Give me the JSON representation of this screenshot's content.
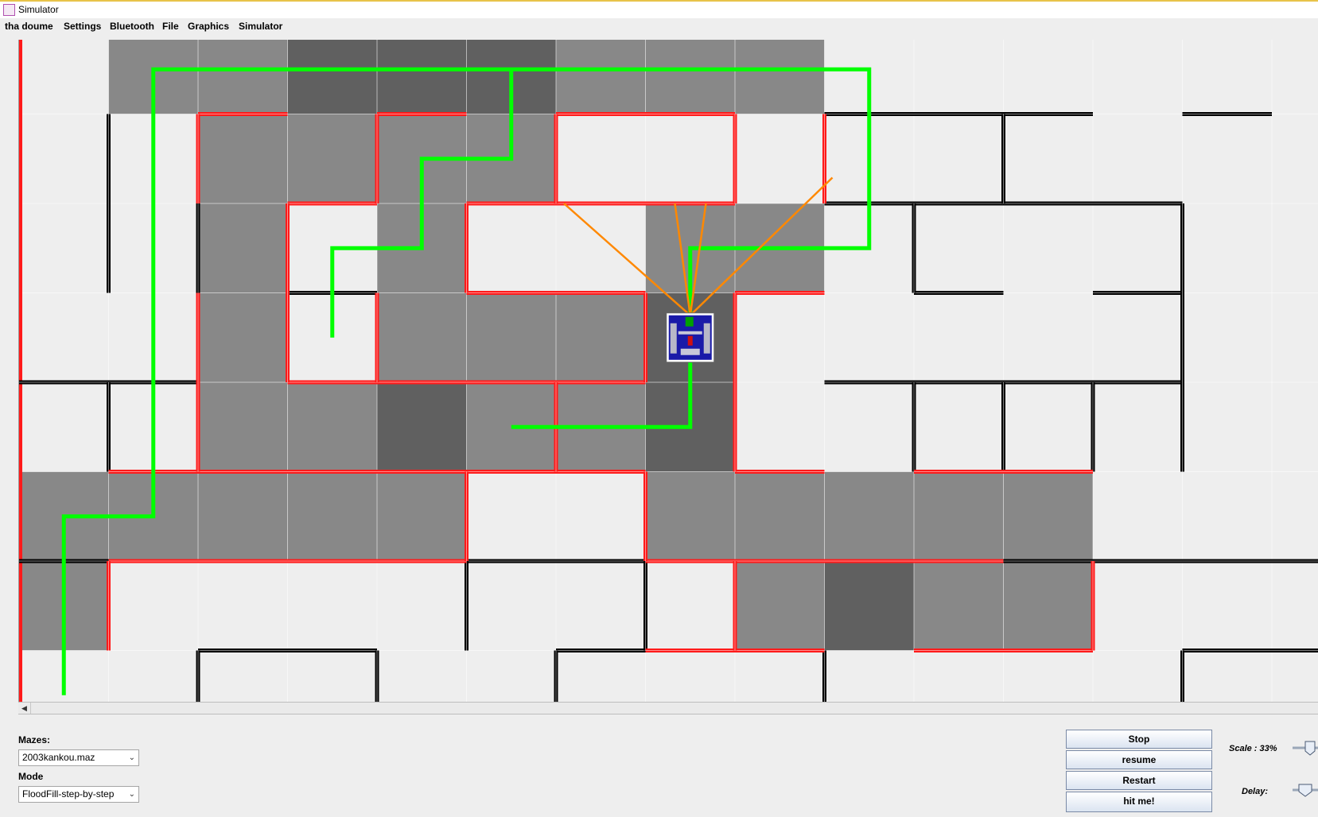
{
  "window": {
    "title": "Simulator"
  },
  "menu": [
    "tha doume",
    "Settings",
    "Bluetooth",
    "File",
    "Graphics",
    "Simulator"
  ],
  "controls": {
    "mazes_label": "Mazes:",
    "maze_selected": "2003kankou.maz",
    "mode_label": "Mode",
    "mode_selected": "FloodFill-step-by-step"
  },
  "buttons": {
    "stop": "Stop",
    "resume": "resume",
    "restart": "Restart",
    "hit": "hit me!"
  },
  "scale_label": "Scale : 33%",
  "delay_label": "Delay:",
  "colors": {
    "floor": "#eeeeee",
    "visited": "#888888",
    "visited_dark": "#606060",
    "path": "#00ff00",
    "known_wall": "#ff1a1a",
    "wall": "#000000",
    "sensor": "#ff8800"
  },
  "maze": {
    "cells_visited": [
      [
        1,
        0
      ],
      [
        2,
        0
      ],
      [
        6,
        0
      ],
      [
        7,
        0
      ],
      [
        8,
        0
      ],
      [
        2,
        1
      ],
      [
        3,
        1
      ],
      [
        4,
        1
      ],
      [
        5,
        1
      ],
      [
        2,
        2
      ],
      [
        4,
        2
      ],
      [
        7,
        2
      ],
      [
        8,
        2
      ],
      [
        2,
        3
      ],
      [
        4,
        3
      ],
      [
        5,
        3
      ],
      [
        6,
        3
      ],
      [
        2,
        4
      ],
      [
        3,
        4
      ],
      [
        5,
        4
      ],
      [
        6,
        4
      ],
      [
        0,
        5
      ],
      [
        1,
        5
      ],
      [
        2,
        5
      ],
      [
        3,
        5
      ],
      [
        4,
        5
      ],
      [
        7,
        5
      ],
      [
        8,
        5
      ],
      [
        9,
        5
      ],
      [
        10,
        5
      ],
      [
        11,
        5
      ],
      [
        0,
        6
      ],
      [
        8,
        6
      ],
      [
        10,
        6
      ],
      [
        11,
        6
      ]
    ],
    "cells_visited_dark": [
      [
        3,
        0
      ],
      [
        4,
        0
      ],
      [
        5,
        0
      ],
      [
        4,
        4
      ],
      [
        7,
        3
      ],
      [
        7,
        4
      ],
      [
        9,
        6
      ]
    ],
    "h_walls_known": [
      [
        2,
        1,
        1
      ],
      [
        4,
        1,
        1
      ],
      [
        6,
        1,
        2
      ],
      [
        3,
        2,
        1
      ],
      [
        5,
        2,
        2
      ],
      [
        7,
        2,
        1
      ],
      [
        5,
        3,
        2
      ],
      [
        8,
        3,
        1
      ],
      [
        3,
        4,
        3
      ],
      [
        6,
        4,
        1
      ],
      [
        1,
        5,
        4
      ],
      [
        5,
        5,
        2
      ],
      [
        8,
        5,
        1
      ],
      [
        10,
        5,
        2
      ],
      [
        1,
        6,
        4
      ],
      [
        7,
        6,
        4
      ],
      [
        7,
        7,
        2
      ],
      [
        10,
        7,
        2
      ]
    ],
    "h_walls_black": [
      [
        9,
        1,
        3
      ],
      [
        13,
        1,
        1
      ],
      [
        9,
        2,
        4
      ],
      [
        1,
        4,
        1
      ],
      [
        0,
        4,
        1
      ],
      [
        9,
        4,
        4
      ],
      [
        11,
        2,
        2
      ],
      [
        10,
        3,
        1
      ],
      [
        12,
        3,
        1
      ],
      [
        5,
        3,
        0
      ],
      [
        3,
        3,
        1
      ],
      [
        0,
        6,
        1
      ],
      [
        5,
        6,
        2
      ],
      [
        11,
        6,
        1
      ],
      [
        12,
        6,
        3
      ],
      [
        2,
        7,
        2
      ],
      [
        6,
        7,
        1
      ],
      [
        13,
        7,
        2
      ]
    ],
    "v_walls_known": [
      [
        2,
        1,
        1
      ],
      [
        4,
        1,
        1
      ],
      [
        6,
        1,
        1
      ],
      [
        8,
        1,
        1
      ],
      [
        9,
        1,
        1
      ],
      [
        3,
        2,
        1
      ],
      [
        5,
        2,
        1
      ],
      [
        3,
        3,
        1
      ],
      [
        4,
        3,
        1
      ],
      [
        7,
        3,
        1
      ],
      [
        8,
        3,
        2
      ],
      [
        2,
        3,
        2
      ],
      [
        6,
        4,
        1
      ],
      [
        1,
        6,
        1
      ],
      [
        5,
        5,
        1
      ],
      [
        7,
        5,
        1
      ],
      [
        8,
        6,
        1
      ],
      [
        12,
        6,
        1
      ]
    ],
    "v_walls_black": [
      [
        1,
        1,
        2
      ],
      [
        2,
        2,
        1
      ],
      [
        11,
        1,
        1
      ],
      [
        10,
        2,
        1
      ],
      [
        13,
        2,
        3
      ],
      [
        11,
        4,
        1
      ],
      [
        12,
        4,
        1
      ],
      [
        10,
        4,
        1
      ],
      [
        4,
        3,
        0
      ],
      [
        1,
        4,
        1
      ],
      [
        5,
        6,
        1
      ],
      [
        7,
        6,
        1
      ],
      [
        9,
        7,
        1
      ],
      [
        13,
        7,
        1
      ],
      [
        2,
        7,
        1
      ],
      [
        4,
        7,
        1
      ],
      [
        6,
        7,
        1
      ]
    ],
    "path_cells": [
      [
        5,
        4
      ],
      [
        7,
        4
      ],
      [
        7,
        3
      ],
      [
        7,
        2
      ],
      [
        9,
        2
      ],
      [
        9,
        0
      ],
      [
        1,
        0
      ],
      [
        1,
        5
      ],
      [
        0,
        5
      ],
      [
        0,
        7
      ]
    ],
    "path_branch": [
      [
        3,
        3
      ],
      [
        3,
        2
      ],
      [
        4,
        2
      ],
      [
        4,
        1
      ],
      [
        5,
        1
      ],
      [
        5,
        0
      ]
    ],
    "robot_cell": [
      7,
      3
    ]
  }
}
